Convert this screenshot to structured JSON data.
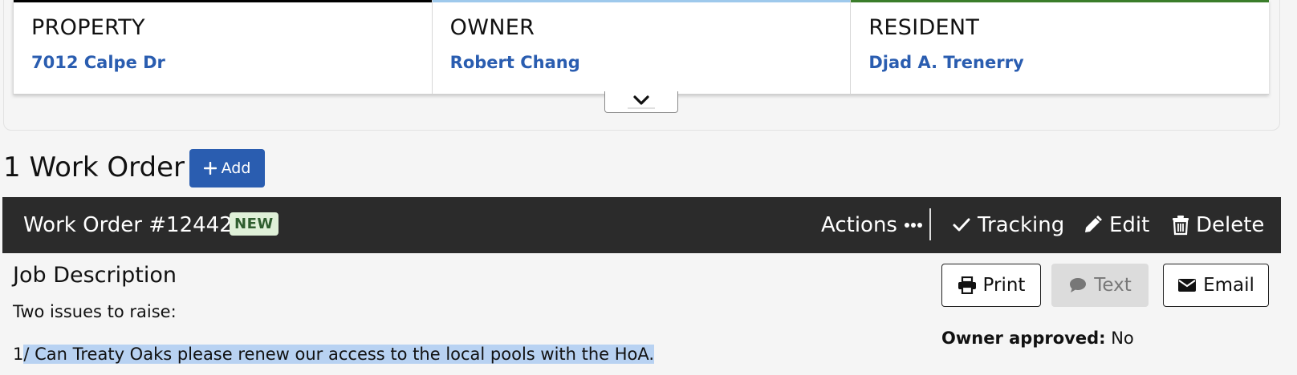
{
  "cards": [
    {
      "label": "PROPERTY",
      "value": "7012 Calpe Dr",
      "accent": "#000000"
    },
    {
      "label": "OWNER",
      "value": "Robert Chang",
      "accent": "#9ec9ec"
    },
    {
      "label": "RESIDENT",
      "value": "Djad A. Trenerry",
      "accent": "#3a7d2a"
    }
  ],
  "expand_icon": "chevron-down-icon",
  "work_orders": {
    "heading": "1 Work Order",
    "add_label": "Add"
  },
  "work_order": {
    "title": "Work Order #12442-1",
    "status": "NEW",
    "actions_label": "Actions",
    "tracking_label": "Tracking",
    "edit_label": "Edit",
    "delete_label": "Delete"
  },
  "job": {
    "title": "Job Description",
    "line1": "Two issues to raise:",
    "line2_prefix": "1",
    "line2_highlight": "/ Can Treaty Oaks please renew our access to the local pools with the HoA."
  },
  "output_buttons": {
    "print": "Print",
    "text": "Text",
    "email": "Email"
  },
  "owner_approved": {
    "label": "Owner approved:",
    "value": "No"
  },
  "colors": {
    "brand": "#2a5db0",
    "bar": "#2b2b2b",
    "badge_bg": "#dff0d8",
    "highlight": "#b8d2f2"
  }
}
